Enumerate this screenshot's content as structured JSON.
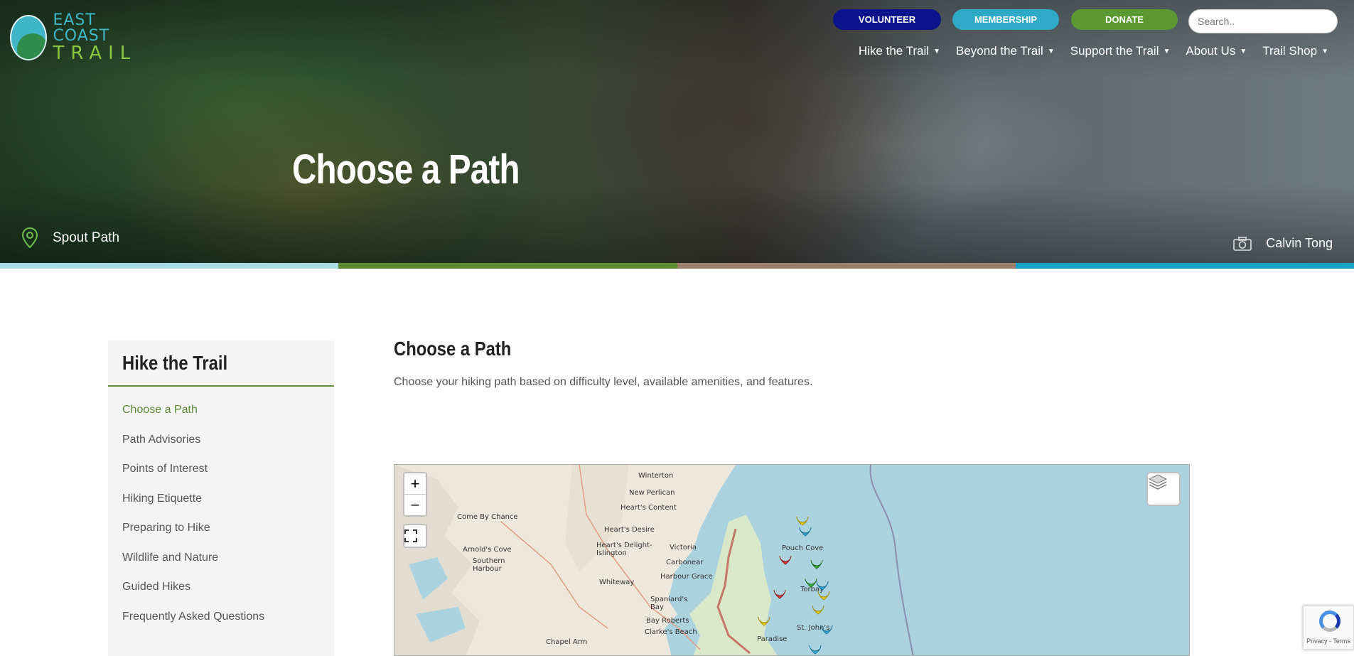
{
  "header": {
    "logo": {
      "line1": "EAST COAST",
      "line2": "TRAIL"
    },
    "buttons": {
      "volunteer": "VOLUNTEER",
      "membership": "MEMBERSHIP",
      "donate": "DONATE"
    },
    "search": {
      "placeholder": "Search.."
    },
    "nav": [
      {
        "label": "Hike the Trail"
      },
      {
        "label": "Beyond the Trail"
      },
      {
        "label": "Support the Trail"
      },
      {
        "label": "About Us"
      },
      {
        "label": "Trail Shop"
      }
    ]
  },
  "hero": {
    "title": "Choose a Path",
    "location": "Spout Path",
    "photo_credit": "Calvin Tong",
    "stripe_colors": [
      "#a8dbe3",
      "#5b8a32",
      "#9b7f6a",
      "#1ba0c8"
    ]
  },
  "sidebar": {
    "title": "Hike the Trail",
    "items": [
      {
        "label": "Choose a Path",
        "active": true
      },
      {
        "label": "Path Advisories"
      },
      {
        "label": "Points of Interest"
      },
      {
        "label": "Hiking Etiquette"
      },
      {
        "label": "Preparing to Hike"
      },
      {
        "label": "Wildlife and Nature"
      },
      {
        "label": "Guided Hikes"
      },
      {
        "label": "Frequently Asked Questions"
      }
    ]
  },
  "main": {
    "title": "Choose a Path",
    "description": "Choose your hiking path based on difficulty level, available amenities, and features."
  },
  "map": {
    "zoom_in": "+",
    "zoom_out": "−",
    "places": [
      "Winterton",
      "New Perlican",
      "Heart's Content",
      "Come By Chance",
      "Heart's Desire",
      "Victoria",
      "Arnold's Cove",
      "Heart's Delight-Islington",
      "Carbonear",
      "Southern Harbour",
      "Harbour Grace",
      "Whiteway",
      "Spaniard's Bay",
      "Bay Roberts",
      "Clarke's Beach",
      "Chapel Arm",
      "Pouch Cove",
      "Torbay",
      "St. John's",
      "Paradise"
    ]
  },
  "recaptcha": {
    "text": "Privacy - Terms"
  }
}
